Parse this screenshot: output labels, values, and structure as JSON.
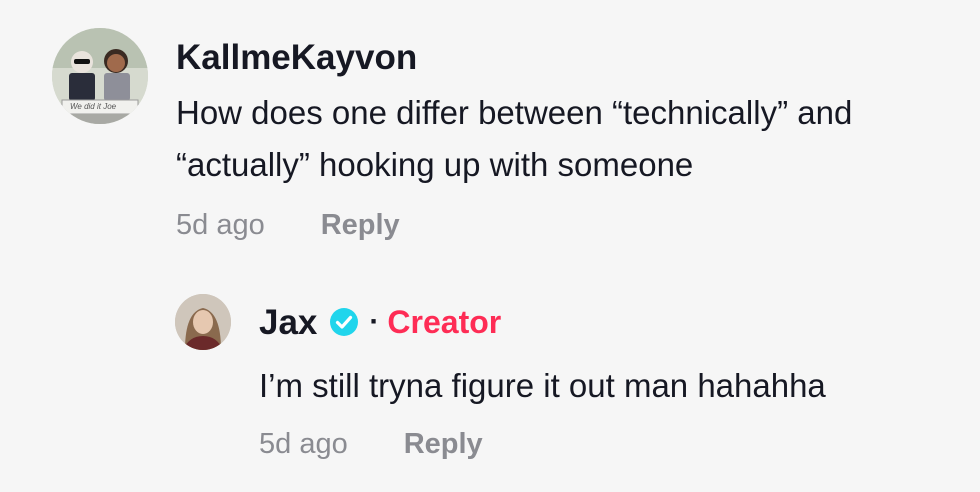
{
  "comment": {
    "username": "KallmeKayvon",
    "avatar_caption": "We did it Joe",
    "text_line1": "How does one differ between “technically” and",
    "text_line2": "“actually” hooking up with someone",
    "time": "5d ago",
    "reply_label": "Reply"
  },
  "reply": {
    "username": "Jax",
    "verified_icon": "verified-check-icon",
    "separator": "·",
    "creator_label": "Creator",
    "text": "I’m still tryna figure it out man hahahha",
    "time": "5d ago",
    "reply_label": "Reply"
  },
  "colors": {
    "background": "#f6f6f6",
    "text": "#161823",
    "meta": "#8a8b91",
    "creator": "#fe2c55",
    "verified": "#20d5ec"
  }
}
